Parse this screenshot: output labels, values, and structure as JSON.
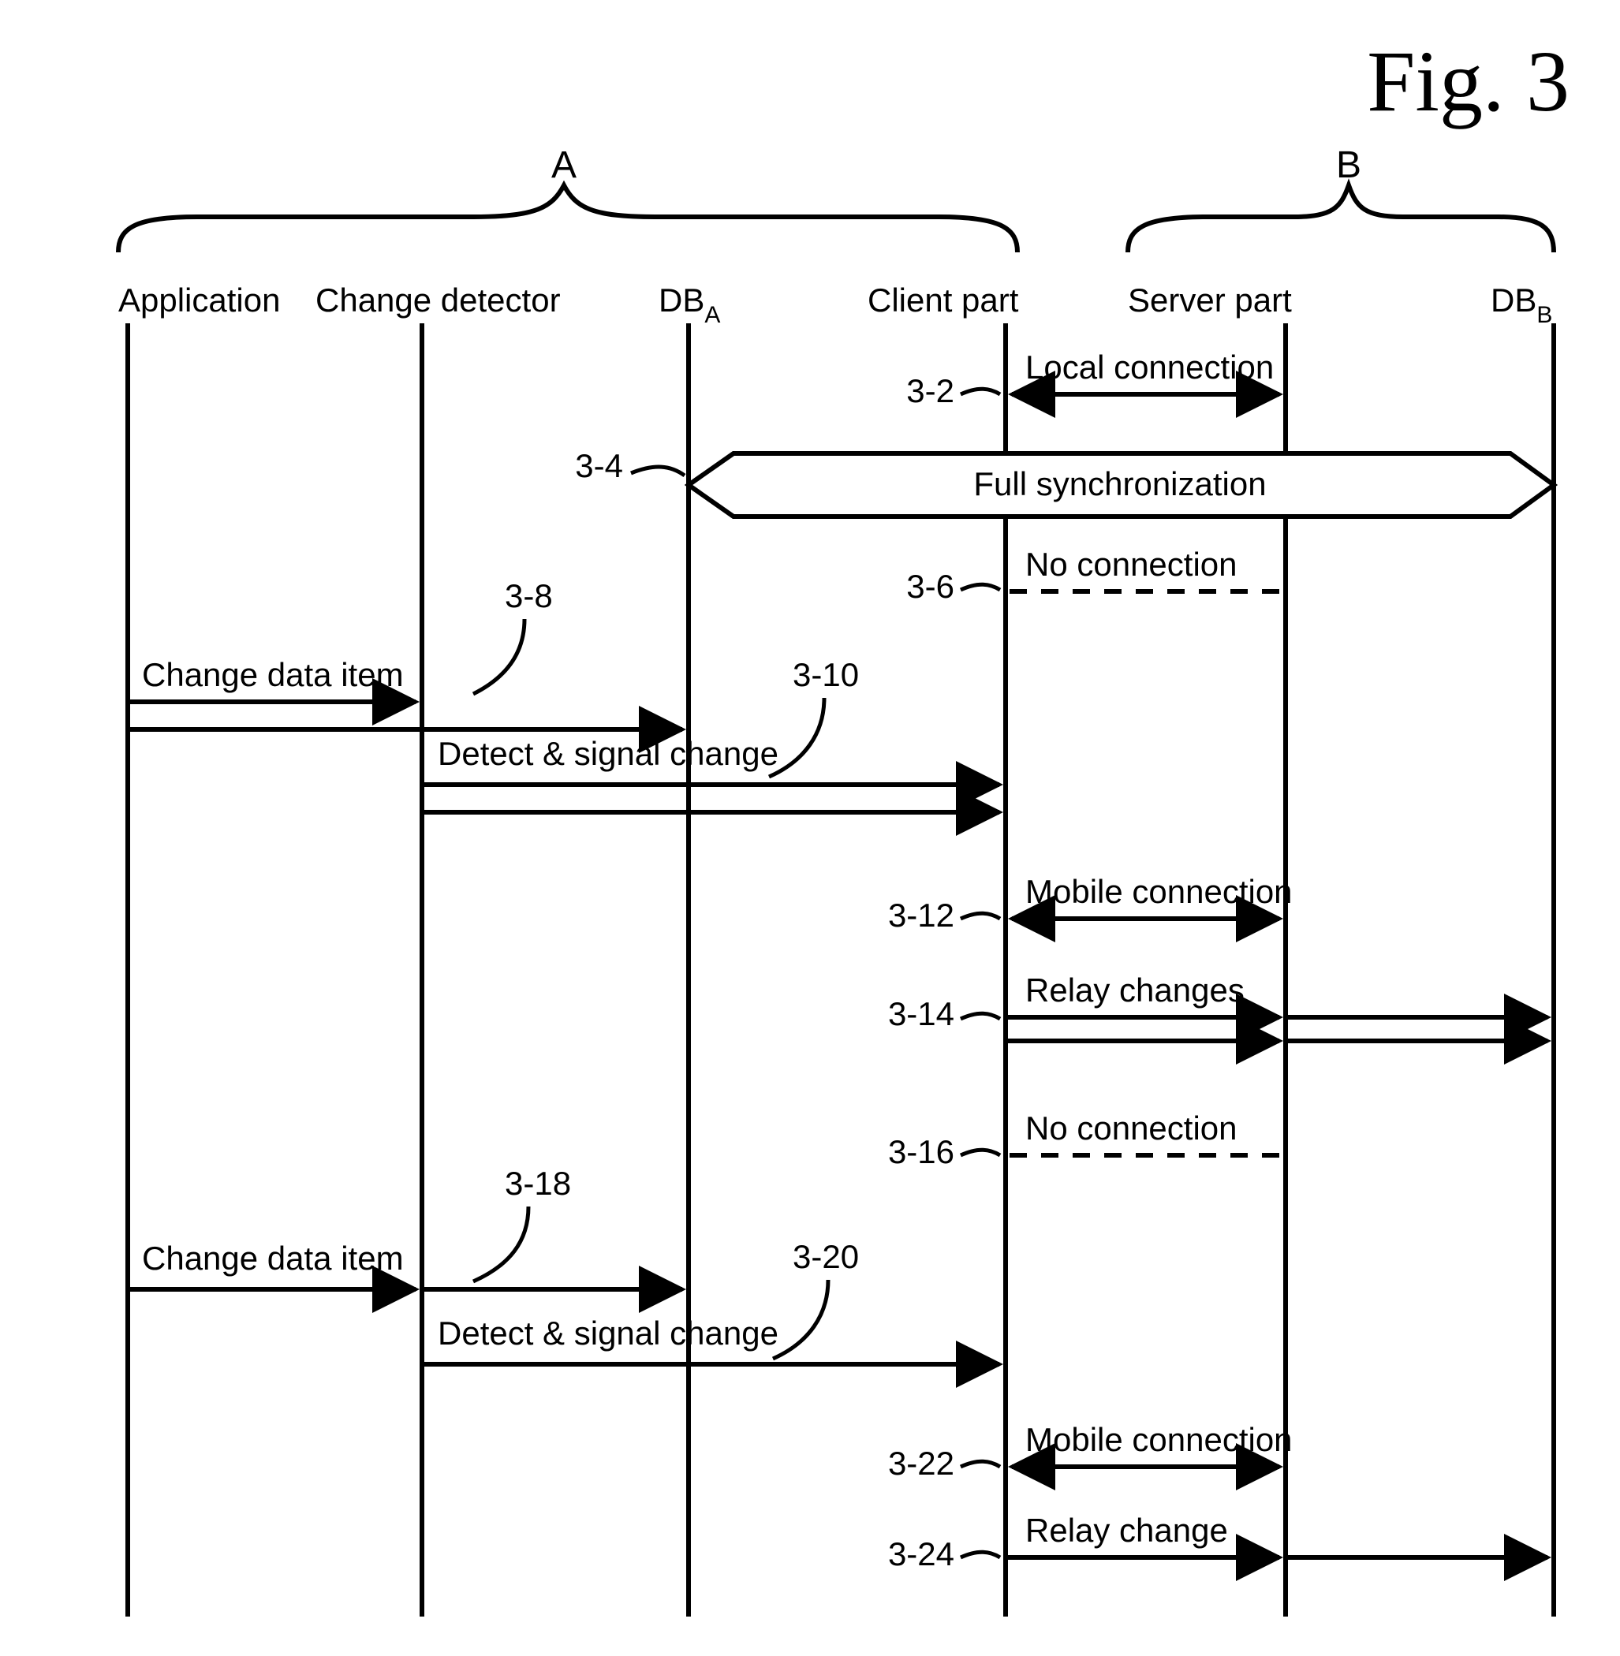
{
  "figure_label": "Fig. 3",
  "groups": {
    "A": "A",
    "B": "B"
  },
  "lifelines": {
    "application": "Application",
    "change_detector": "Change detector",
    "db_a": "DB",
    "db_a_sub": "A",
    "client_part": "Client part",
    "server_part": "Server part",
    "db_b": "DB",
    "db_b_sub": "B"
  },
  "steps": {
    "s3_2": {
      "ref": "3-2",
      "label": "Local connection"
    },
    "s3_4": {
      "ref": "3-4",
      "label": "Full synchronization"
    },
    "s3_6": {
      "ref": "3-6",
      "label": "No connection"
    },
    "s3_8": {
      "ref": "3-8",
      "label": "Change data item"
    },
    "s3_10": {
      "ref": "3-10",
      "label": "Detect & signal change"
    },
    "s3_12": {
      "ref": "3-12",
      "label": "Mobile connection"
    },
    "s3_14": {
      "ref": "3-14",
      "label": "Relay changes"
    },
    "s3_16": {
      "ref": "3-16",
      "label": "No connection"
    },
    "s3_18": {
      "ref": "3-18",
      "label": "Change data item"
    },
    "s3_20": {
      "ref": "3-20",
      "label": "Detect & signal change"
    },
    "s3_22": {
      "ref": "3-22",
      "label": "Mobile connection"
    },
    "s3_24": {
      "ref": "3-24",
      "label": "Relay change"
    }
  },
  "chart_data": {
    "type": "sequence-diagram",
    "groups": [
      {
        "name": "A",
        "members": [
          "Application",
          "Change detector",
          "DB_A",
          "Client part"
        ]
      },
      {
        "name": "B",
        "members": [
          "Server part",
          "DB_B"
        ]
      }
    ],
    "lifelines": [
      "Application",
      "Change detector",
      "DB_A",
      "Client part",
      "Server part",
      "DB_B"
    ],
    "messages": [
      {
        "id": "3-2",
        "text": "Local connection",
        "from": "Client part",
        "to": "Server part",
        "kind": "double-arrow"
      },
      {
        "id": "3-4",
        "text": "Full synchronization",
        "from": "DB_A",
        "to": "DB_B",
        "kind": "block"
      },
      {
        "id": "3-6",
        "text": "No connection",
        "from": "Client part",
        "to": "Server part",
        "kind": "dashed"
      },
      {
        "id": "3-8",
        "text": "Change data item",
        "from": "Application",
        "to": "Change detector",
        "kind": "arrow",
        "multiplicity": 2,
        "also_to": "DB_A"
      },
      {
        "id": "3-10",
        "text": "Detect & signal change",
        "from": "Change detector",
        "to": "Client part",
        "kind": "arrow",
        "multiplicity": 2
      },
      {
        "id": "3-12",
        "text": "Mobile connection",
        "from": "Client part",
        "to": "Server part",
        "kind": "double-arrow"
      },
      {
        "id": "3-14",
        "text": "Relay changes",
        "from": "Client part",
        "to": "DB_B",
        "via": "Server part",
        "kind": "arrow",
        "multiplicity": 2
      },
      {
        "id": "3-16",
        "text": "No connection",
        "from": "Client part",
        "to": "Server part",
        "kind": "dashed"
      },
      {
        "id": "3-18",
        "text": "Change data item",
        "from": "Application",
        "to": "DB_A",
        "via": "Change detector",
        "kind": "arrow"
      },
      {
        "id": "3-20",
        "text": "Detect & signal change",
        "from": "Change detector",
        "to": "Client part",
        "kind": "arrow"
      },
      {
        "id": "3-22",
        "text": "Mobile connection",
        "from": "Client part",
        "to": "Server part",
        "kind": "double-arrow"
      },
      {
        "id": "3-24",
        "text": "Relay change",
        "from": "Client part",
        "to": "DB_B",
        "via": "Server part",
        "kind": "arrow"
      }
    ]
  }
}
